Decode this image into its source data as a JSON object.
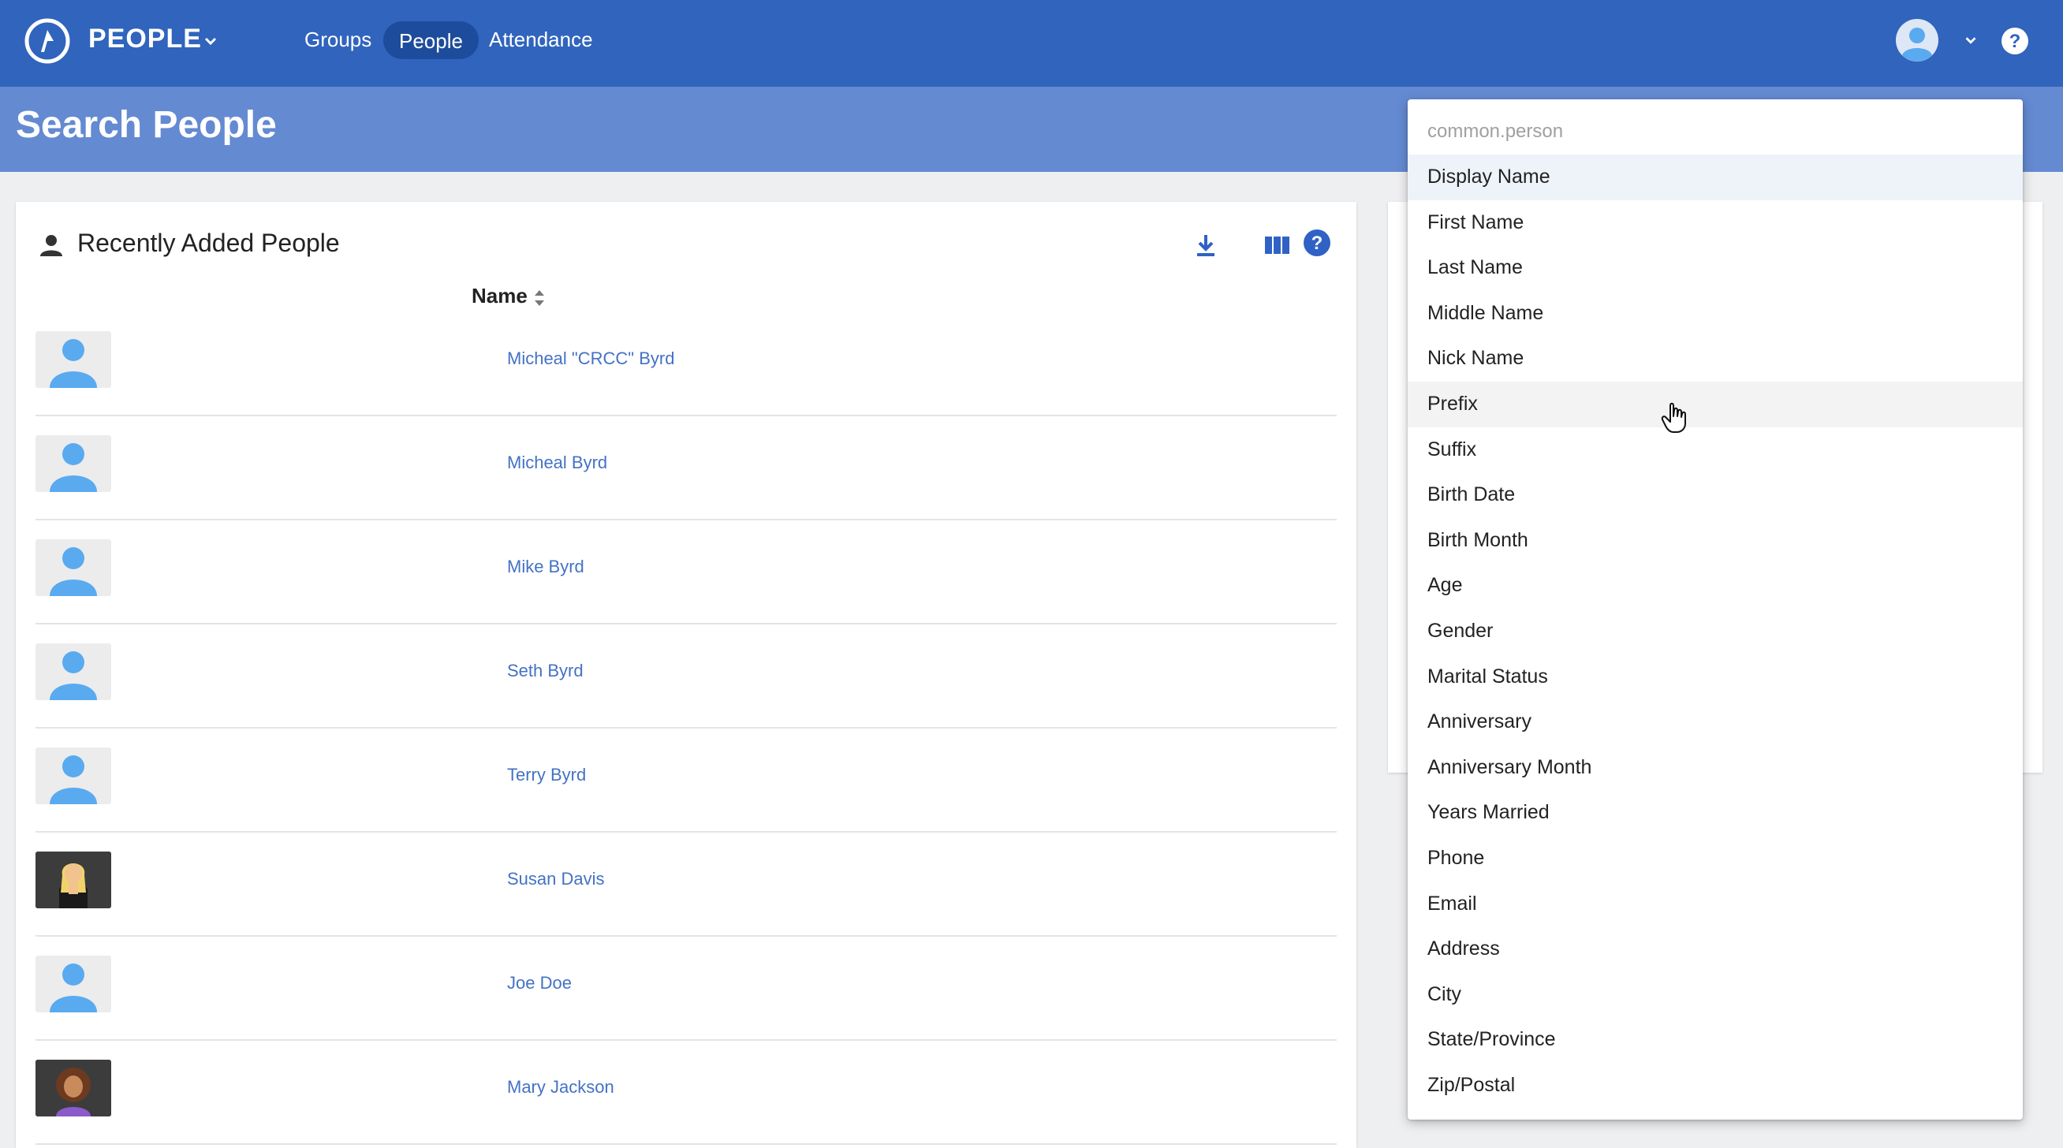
{
  "app": {
    "name": "PEOPLE"
  },
  "nav": {
    "groups": "Groups",
    "people": "People",
    "attendance": "Attendance"
  },
  "page": {
    "title": "Search People"
  },
  "card": {
    "title": "Recently Added People",
    "column_name": "Name"
  },
  "people": [
    {
      "name": "Micheal \"CRCC\" Byrd",
      "photo": "default-avatar"
    },
    {
      "name": "Micheal Byrd",
      "photo": "default-avatar"
    },
    {
      "name": "Mike Byrd",
      "photo": "default-avatar"
    },
    {
      "name": "Seth Byrd",
      "photo": "default-avatar"
    },
    {
      "name": "Terry Byrd",
      "photo": "default-avatar"
    },
    {
      "name": "Susan Davis",
      "photo": "photo-blonde-woman"
    },
    {
      "name": "Joe Doe",
      "photo": "default-avatar"
    },
    {
      "name": "Mary Jackson",
      "photo": "photo-curly-hair-woman"
    }
  ],
  "dropdown": {
    "group_label": "common.person",
    "items": [
      "Display Name",
      "First Name",
      "Last Name",
      "Middle Name",
      "Nick Name",
      "Prefix",
      "Suffix",
      "Birth Date",
      "Birth Month",
      "Age",
      "Gender",
      "Marital Status",
      "Anniversary",
      "Anniversary Month",
      "Years Married",
      "Phone",
      "Email",
      "Address",
      "City",
      "State/Province",
      "Zip/Postal"
    ],
    "selected": "Display Name",
    "hovered": "Prefix"
  },
  "colors": {
    "topbar": "#3064bd",
    "subheader": "#648ad2",
    "link": "#4472c4",
    "accent": "#2f62c4"
  }
}
